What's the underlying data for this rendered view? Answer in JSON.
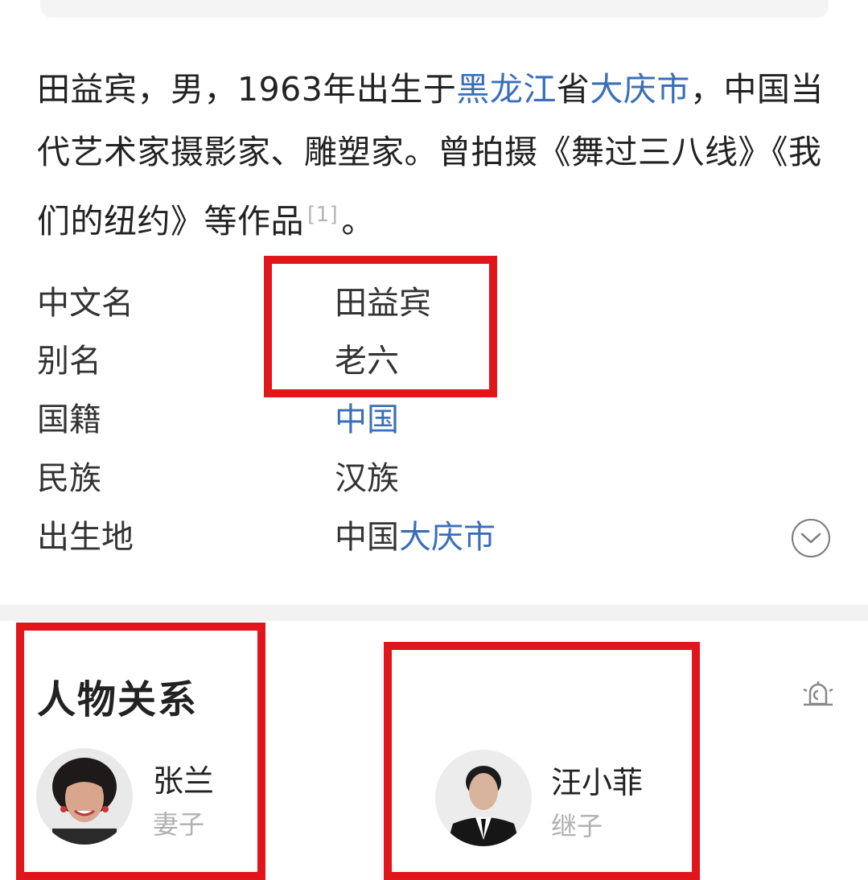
{
  "summary": {
    "part1": "田益宾，男，1963年出生于",
    "link1": "黑龙江",
    "part2": "省",
    "link2": "大庆市",
    "part3": "，中国当代艺术家摄影家、雕塑家。曾拍摄《舞过三八线》《我们的纽约》等作品",
    "ref": "[1]",
    "part4": "。"
  },
  "info": {
    "rows": [
      {
        "label": "中文名",
        "value": "田益宾"
      },
      {
        "label": "别名",
        "value": "老六"
      },
      {
        "label": "国籍",
        "value": "中国"
      },
      {
        "label": "民族",
        "value": "汉族"
      },
      {
        "label": "出生地",
        "value_prefix": "中国",
        "value_link": "大庆市"
      }
    ]
  },
  "relations": {
    "title": "人物关系",
    "people": [
      {
        "name": "张兰",
        "role": "妻子"
      },
      {
        "name": "汪小菲",
        "role": "继子"
      }
    ]
  },
  "colors": {
    "link": "#3a6fb8",
    "highlight": "#e0161b",
    "role_text": "#b0b0b0"
  },
  "icons": {
    "expand": "chevron-down-icon",
    "relation_graph": "relation-graph-icon"
  }
}
